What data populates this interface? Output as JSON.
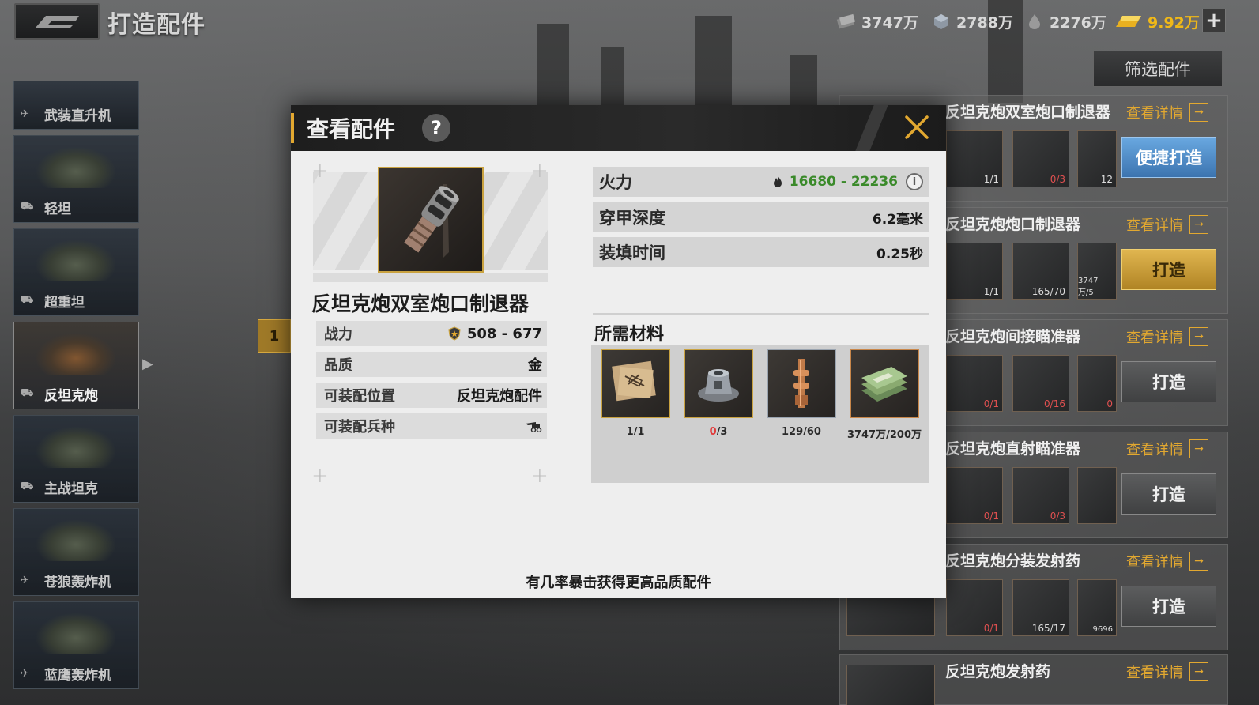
{
  "header": {
    "title": "打造配件",
    "filter_label": "筛选配件"
  },
  "currencies": [
    {
      "icon": "cash-icon",
      "value": "3747万"
    },
    {
      "icon": "steel-icon",
      "value": "2788万"
    },
    {
      "icon": "oil-icon",
      "value": "2276万"
    },
    {
      "icon": "gold-icon",
      "value": "9.92万"
    }
  ],
  "sidebar": {
    "items": [
      {
        "label": "武装直升机"
      },
      {
        "label": "轻坦"
      },
      {
        "label": "超重坦"
      },
      {
        "label": "反坦克炮"
      },
      {
        "label": "主战坦克"
      },
      {
        "label": "苍狼轰炸机"
      },
      {
        "label": "蓝鹰轰炸机"
      }
    ]
  },
  "recipes": [
    {
      "name": "反坦克炮双室炮口制退器",
      "detail": "查看详情",
      "button": "便捷打造",
      "counts": [
        "1/1",
        "0/3",
        "12"
      ]
    },
    {
      "name": "反坦克炮炮口制退器",
      "detail": "查看详情",
      "button": "打造",
      "counts": [
        "1/1",
        "165/70",
        "3747万/5"
      ]
    },
    {
      "name": "反坦克炮间接瞄准器",
      "detail": "查看详情",
      "button": "打造",
      "counts": [
        "0/1",
        "0/16",
        "0"
      ]
    },
    {
      "name": "反坦克炮直射瞄准器",
      "detail": "查看详情",
      "button": "打造",
      "counts": [
        "0/1",
        "0/3",
        ""
      ]
    },
    {
      "name": "反坦克炮分装发射药",
      "detail": "查看详情",
      "button": "打造",
      "counts": [
        "0/1",
        "165/17",
        "9696"
      ]
    },
    {
      "name": "反坦克炮发射药",
      "detail": "查看详情",
      "button": "",
      "counts": []
    }
  ],
  "behind_badge": "1",
  "modal": {
    "title": "查看配件",
    "help_label": "?",
    "part_name": "反坦克炮双室炮口制退器",
    "attrs": {
      "power_label": "战力",
      "power_value": "508 - 677",
      "quality_label": "品质",
      "quality_value": "金",
      "position_label": "可装配位置",
      "position_value": "反坦克炮配件",
      "type_label": "可装配兵种"
    },
    "stats": {
      "firepower_label": "火力",
      "firepower_value": "16680 - 22236",
      "penetration_label": "穿甲深度",
      "penetration_value": "6.2毫米",
      "reload_label": "装填时间",
      "reload_value": "0.25秒"
    },
    "materials_title": "所需材料",
    "materials": [
      {
        "icon": "blueprint-icon",
        "have": "1",
        "need": "1",
        "lacking": false
      },
      {
        "icon": "gear-part-icon",
        "have": "0",
        "need": "3",
        "lacking": true
      },
      {
        "icon": "copper-rod-icon",
        "have": "129",
        "need": "60",
        "lacking": false
      },
      {
        "icon": "cash-stack-icon",
        "have": "3747万",
        "need": "200万",
        "lacking": false
      }
    ],
    "footer": "有几率暴击获得更高品质配件"
  }
}
